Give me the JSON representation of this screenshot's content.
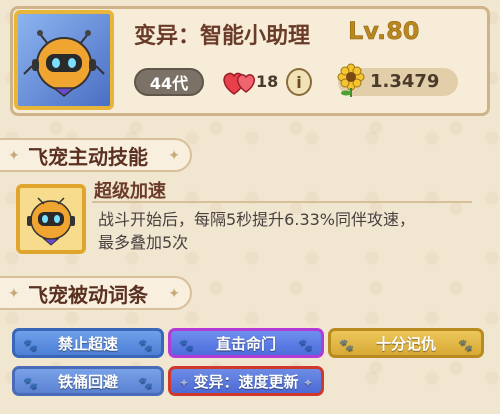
{
  "pet": {
    "title": "变异：智能小助理",
    "level": "Lv.80",
    "generation": "44代",
    "heart_count": "18",
    "power": "1.3479"
  },
  "sections": {
    "active": "飞宠主动技能",
    "passive": "飞宠被动词条"
  },
  "active_skill": {
    "name": "超级加速",
    "description_line1": "战斗开始后，每隔5秒提升6.33%同伴攻速，",
    "description_line2": "最多叠加5次"
  },
  "traits": [
    {
      "label": "禁止超速",
      "style": "blue"
    },
    {
      "label": "直击命门",
      "style": "purple"
    },
    {
      "label": "十分记仇",
      "style": "gold"
    },
    {
      "label": "铁桶回避",
      "style": "blue"
    },
    {
      "label": "变异：速度更新",
      "style": "red"
    }
  ],
  "icons": {
    "portrait": "robot-pet-portrait",
    "skill": "robot-pet-skill-icon",
    "hearts": "hearts-icon",
    "info": "info-icon",
    "power": "sunflower-icon",
    "paw": "paw-icon"
  },
  "colors": {
    "title": "#6b3b2a",
    "level": "#b8871e",
    "trait_blue": "#4d7fd6",
    "trait_gold": "#d8a936",
    "border_purple": "#b23ad6",
    "border_red": "#d0382c"
  }
}
